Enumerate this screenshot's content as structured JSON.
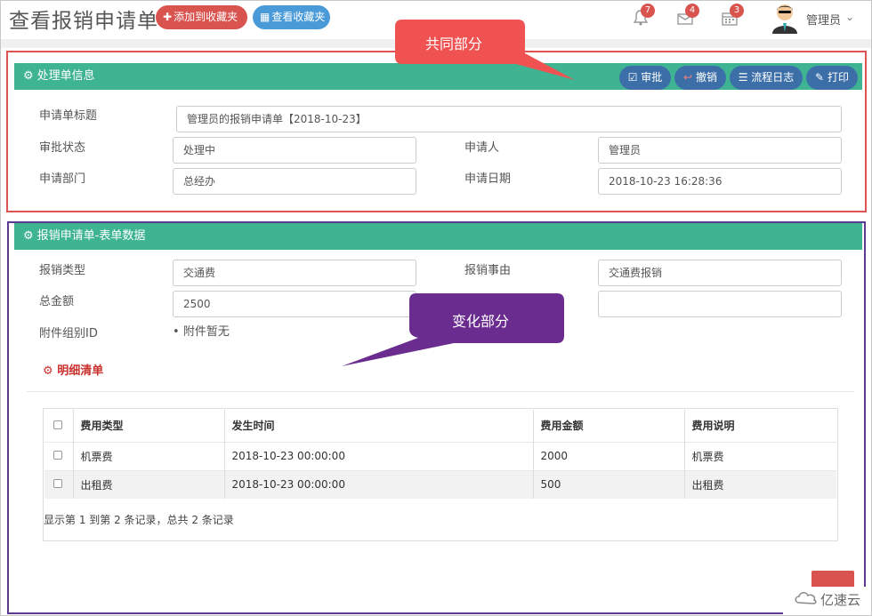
{
  "header": {
    "title": "查看报销申请单",
    "add_favorite": "添加到收藏夹",
    "view_favorite": "查看收藏夹",
    "bell_count": "7",
    "mail_count": "4",
    "calendar_count": "3",
    "user_name": "管理员"
  },
  "process_panel": {
    "title": "处理单信息",
    "buttons": {
      "approve": "审批",
      "revoke": "撤销",
      "flow_log": "流程日志",
      "print": "打印"
    },
    "fields": {
      "title_label": "申请单标题",
      "title_value": "管理员的报销申请单【2018-10-23】",
      "status_label": "审批状态",
      "status_value": "处理中",
      "applicant_label": "申请人",
      "applicant_value": "管理员",
      "dept_label": "申请部门",
      "dept_value": "总经办",
      "date_label": "申请日期",
      "date_value": "2018-10-23 16:28:36"
    }
  },
  "form_panel": {
    "title": "报销申请单-表单数据",
    "fields": {
      "type_label": "报销类型",
      "type_value": "交通费",
      "reason_label": "报销事由",
      "reason_value": "交通费报销",
      "amount_label": "总金额",
      "amount_value": "2500",
      "attach_label": "附件组别ID",
      "attach_value": "附件暂无"
    },
    "detail_title": "明细清单",
    "table": {
      "headers": [
        "费用类型",
        "发生时间",
        "费用金额",
        "费用说明"
      ],
      "rows": [
        [
          "机票费",
          "2018-10-23 00:00:00",
          "2000",
          "机票费"
        ],
        [
          "出租费",
          "2018-10-23 00:00:00",
          "500",
          "出租费"
        ]
      ],
      "summary": "显示第 1 到第 2 条记录，总共 2 条记录"
    }
  },
  "callouts": {
    "common": "共同部分",
    "variable": "变化部分"
  },
  "watermark": "亿速云",
  "colors": {
    "panel_header": "#3fb492",
    "action_button": "#3c6fa8",
    "red_button": "#d9534f",
    "blue_button": "#4a9ad8",
    "callout_red": "#f05252",
    "callout_purple": "#6b2c8f"
  }
}
